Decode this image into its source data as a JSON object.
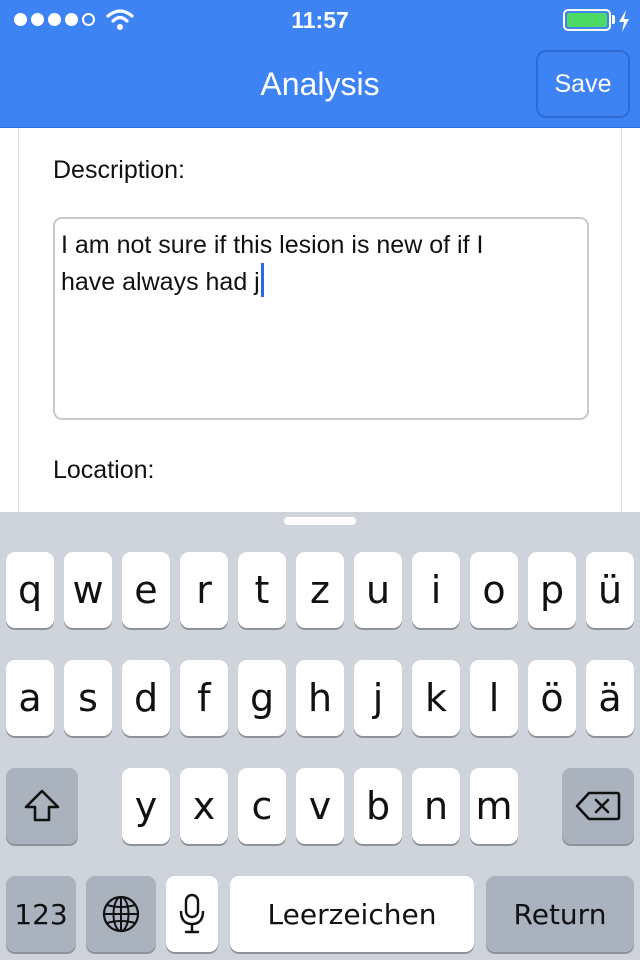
{
  "status": {
    "time": "11:57"
  },
  "nav": {
    "title": "Analysis",
    "save_label": "Save"
  },
  "form": {
    "description_label": "Description:",
    "description_line1": "I am not sure if this lesion is new of if I",
    "description_line2": "have always had j",
    "location_label": "Location:"
  },
  "keyboard": {
    "row1": [
      "q",
      "w",
      "e",
      "r",
      "t",
      "z",
      "u",
      "i",
      "o",
      "p",
      "ü"
    ],
    "row2": [
      "a",
      "s",
      "d",
      "f",
      "g",
      "h",
      "j",
      "k",
      "l",
      "ö",
      "ä"
    ],
    "row3": [
      "y",
      "x",
      "c",
      "v",
      "b",
      "n",
      "m"
    ],
    "numbers_label": "123",
    "space_label": "Leerzeichen",
    "return_label": "Return",
    "icons": [
      "shift-icon",
      "delete-icon",
      "globe-icon",
      "microphone-icon"
    ]
  },
  "colors": {
    "header": "#3d83f3",
    "battery": "#4cd964",
    "caret": "#2d66e8"
  }
}
